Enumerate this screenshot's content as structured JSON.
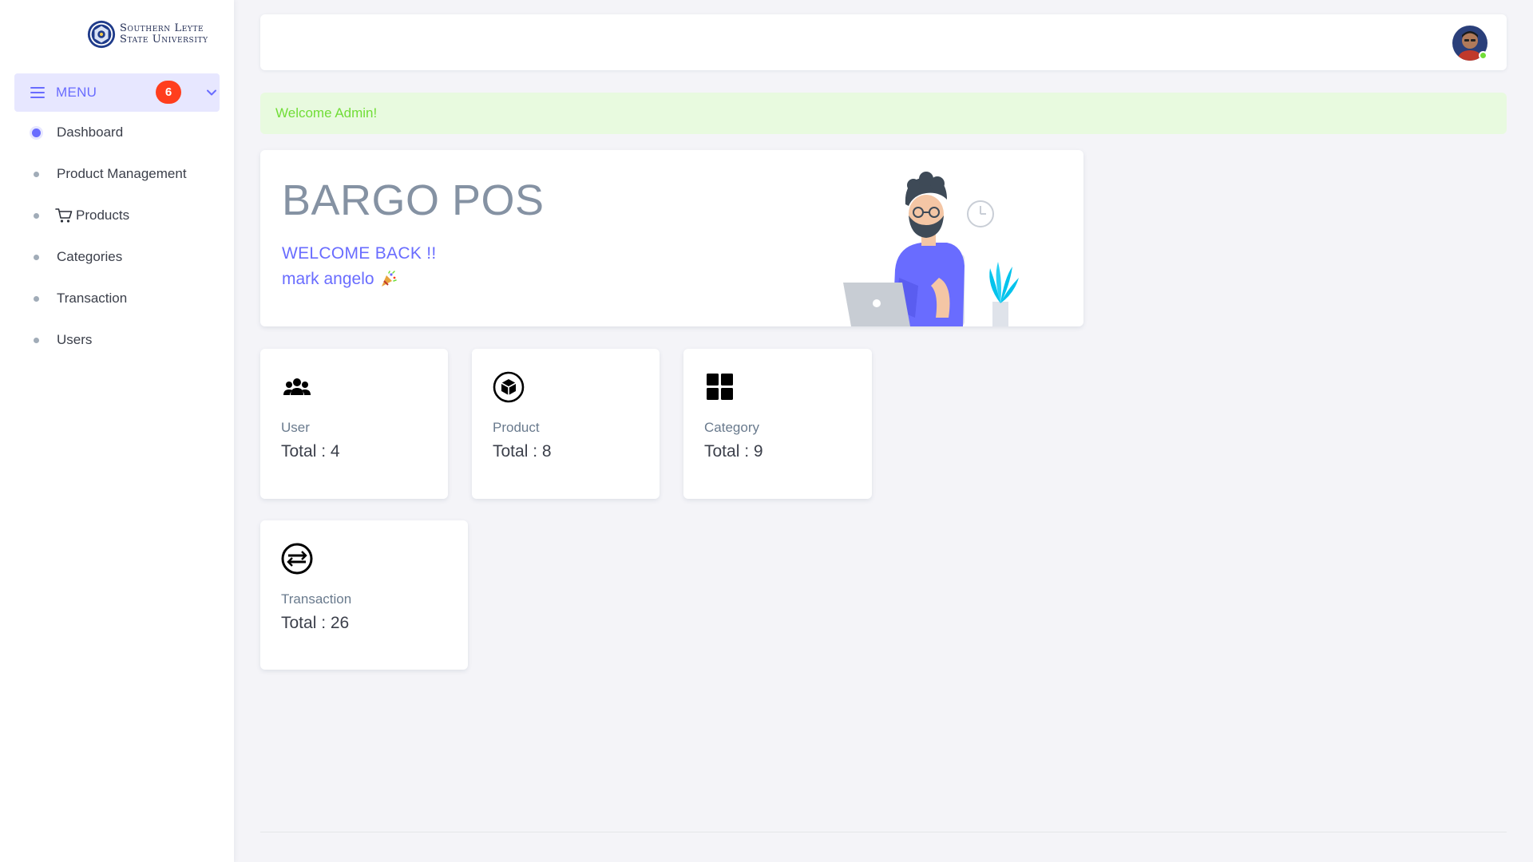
{
  "brand": {
    "line1": "Southern Leyte",
    "line2": "State University"
  },
  "menu": {
    "label": "MENU",
    "badge": "6",
    "accent_color": "#696cff",
    "badge_color": "#ff3e1d"
  },
  "nav": {
    "items": [
      {
        "label": "Dashboard",
        "active": true
      },
      {
        "label": "Product Management"
      },
      {
        "label": "Products",
        "icon": "cart-icon"
      },
      {
        "label": "Categories"
      },
      {
        "label": "Transaction"
      },
      {
        "label": "Users"
      }
    ]
  },
  "alert": {
    "text": "Welcome Admin!",
    "color": "#71dd37"
  },
  "welcome": {
    "title": "BARGO POS",
    "subtitle": "WELCOME BACK !!",
    "name": "mark angelo",
    "name_icon": "party-popper-icon"
  },
  "stats": [
    {
      "label": "User",
      "value": "Total : 4",
      "icon": "users-icon"
    },
    {
      "label": "Product",
      "value": "Total : 8",
      "icon": "box-icon"
    },
    {
      "label": "Category",
      "value": "Total : 9",
      "icon": "grid-icon"
    },
    {
      "label": "Transaction",
      "value": "Total : 26",
      "icon": "transaction-icon"
    }
  ],
  "user": {
    "avatar_icon": "avatar",
    "status": "online"
  }
}
